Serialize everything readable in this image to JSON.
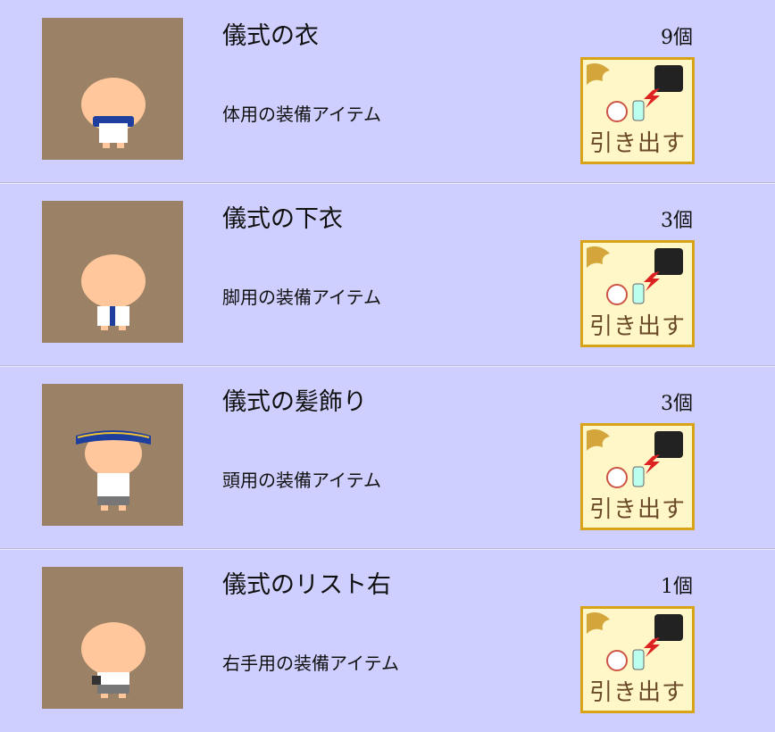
{
  "items": [
    {
      "name": "儀式の衣",
      "description": "体用の装備アイテム",
      "count": "9個",
      "button_label": "引き出す"
    },
    {
      "name": "儀式の下衣",
      "description": "脚用の装備アイテム",
      "count": "3個",
      "button_label": "引き出す"
    },
    {
      "name": "儀式の髪飾り",
      "description": "頭用の装備アイテム",
      "count": "3個",
      "button_label": "引き出す"
    },
    {
      "name": "儀式のリスト右",
      "description": "右手用の装備アイテム",
      "count": "1個",
      "button_label": "引き出す"
    }
  ],
  "colors": {
    "background": "#cfcfff",
    "thumb_bg": "#9b8165",
    "button_bg": "#fff7c8",
    "button_border": "#d9a318",
    "button_text": "#6b4a2a"
  }
}
